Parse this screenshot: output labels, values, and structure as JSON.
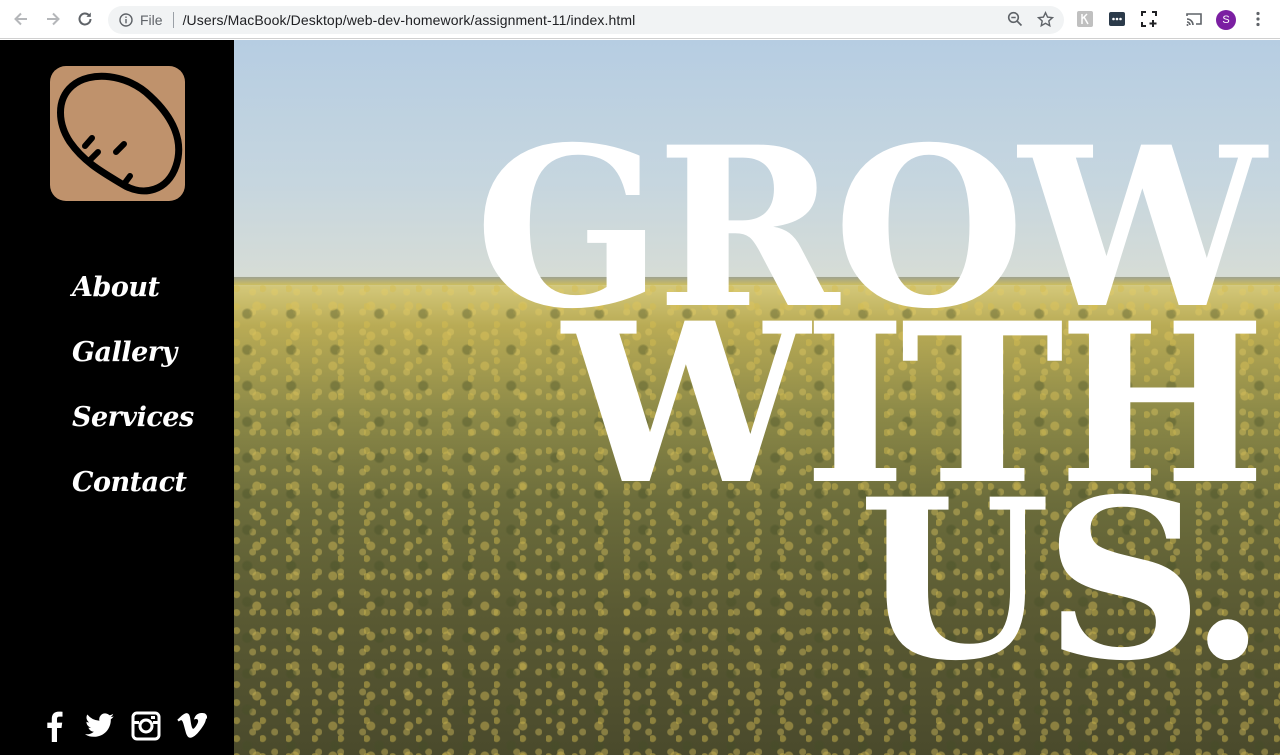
{
  "browser": {
    "scheme": "File",
    "url": "/Users/MacBook/Desktop/web-dev-homework/assignment-11/index.html",
    "profile_initial": "S",
    "icons": [
      "back-icon",
      "forward-icon",
      "reload-icon",
      "info-icon",
      "zoom-icon",
      "star-icon",
      "extension-icon",
      "cast-icon",
      "menu-icon"
    ]
  },
  "site": {
    "logo_icon": "potato-icon",
    "logo_color": "#bf926c",
    "nav": [
      {
        "label": "About"
      },
      {
        "label": "Gallery"
      },
      {
        "label": "Services"
      },
      {
        "label": "Contact"
      }
    ],
    "social": [
      "facebook-icon",
      "twitter-icon",
      "instagram-icon",
      "vimeo-icon"
    ]
  },
  "hero": {
    "line1": "GROW",
    "line2": "WITH",
    "line3": "US."
  }
}
